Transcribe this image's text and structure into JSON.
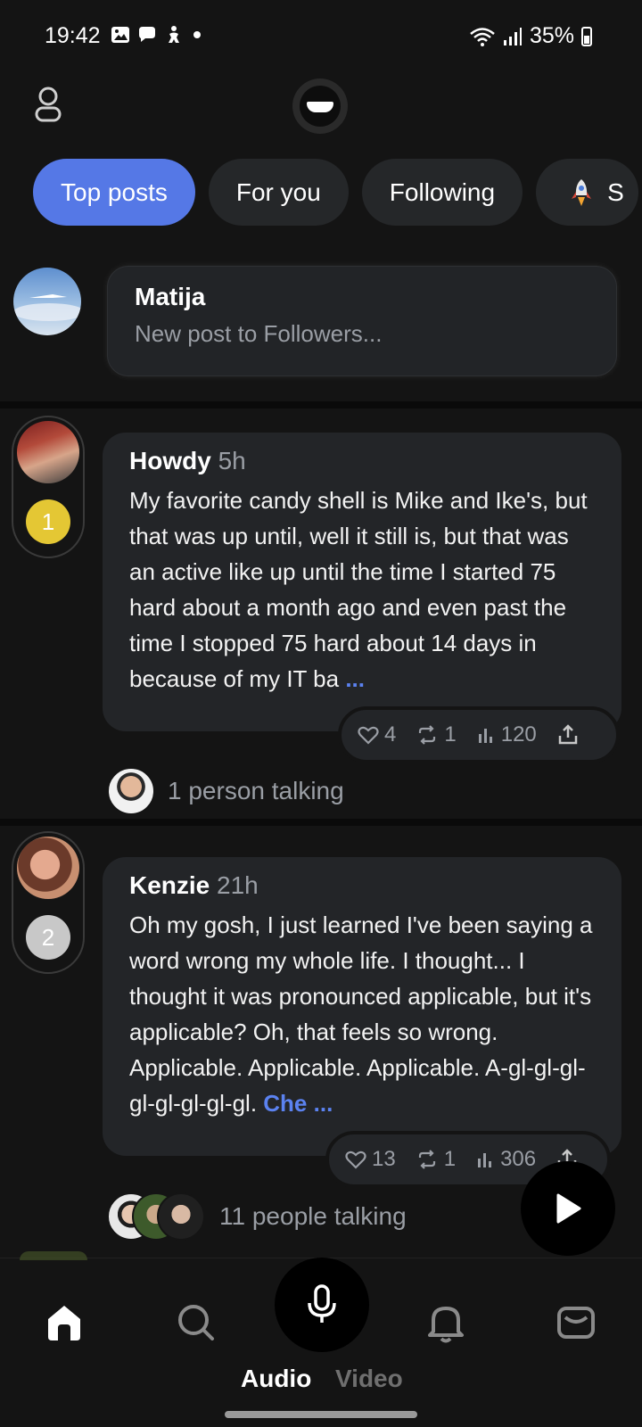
{
  "status_bar": {
    "time": "19:42",
    "battery": "35%",
    "icons": [
      "gallery-icon",
      "chat-bubble-icon",
      "accessibility-icon",
      "dot-icon",
      "wifi-icon",
      "signal-icon",
      "battery-icon"
    ]
  },
  "header": {
    "profile_icon": "person-icon",
    "logo_icon": "app-logo-icon"
  },
  "tabs": [
    {
      "label": "Top posts",
      "active": true
    },
    {
      "label": "For you",
      "active": false
    },
    {
      "label": "Following",
      "active": false
    },
    {
      "label": "S",
      "active": false,
      "icon": "rocket-icon"
    }
  ],
  "compose": {
    "name": "Matija",
    "placeholder": "New post to Followers..."
  },
  "posts": [
    {
      "rank": "1",
      "author": "Howdy",
      "time": "5h",
      "text": "My favorite candy shell is Mike and Ike's, but that was up until, well it still is, but that was an active like up until the time I started 75 hard about a month ago and even past the time I stopped 75 hard about 14 days in because of my IT ba",
      "link_fragment": "",
      "more": "...",
      "likes": "4",
      "reposts": "1",
      "views": "120",
      "talking": "1 person talking"
    },
    {
      "rank": "2",
      "author": "Kenzie",
      "time": "21h",
      "text": "Oh my gosh, I just learned I've been saying a word wrong my whole life. I thought... I thought it was pronounced applicable, but it's applicable? Oh, that feels so wrong. Applicable. Applicable. Applicable. A-gl-gl-gl-gl-gl-gl-gl-gl. ",
      "link_fragment": "Che",
      "more": "...",
      "likes": "13",
      "reposts": "1",
      "views": "306",
      "talking": "11 people talking"
    }
  ],
  "bottom_nav": {
    "audio_label": "Audio",
    "video_label": "Video",
    "items": [
      "home-icon",
      "search-icon",
      "microphone-icon",
      "bell-icon",
      "mail-icon"
    ]
  },
  "colors": {
    "background": "#141414",
    "card": "#232528",
    "accent": "#5578e6",
    "link": "#5b82f0",
    "muted": "#9a9ea5",
    "gold": "#e4c734",
    "silver": "#c8c8c8"
  }
}
